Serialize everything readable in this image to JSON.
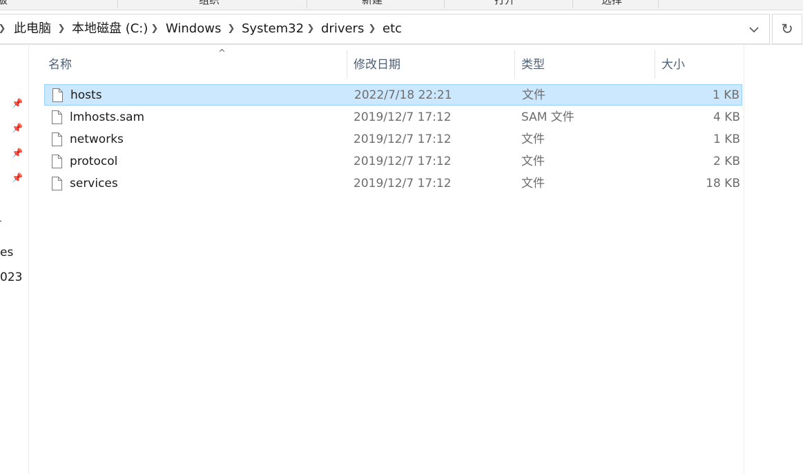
{
  "ribbon": {
    "labels": [
      "版",
      "组织",
      "新建",
      "打开",
      "选择"
    ]
  },
  "address": {
    "crumbs": [
      "此电脑",
      "本地磁盘 (C:)",
      "Windows",
      "System32",
      "drivers",
      "etc"
    ]
  },
  "nav": {
    "fragments": [
      "es",
      "023"
    ]
  },
  "columns": {
    "name": "名称",
    "date": "修改日期",
    "type": "类型",
    "size": "大小"
  },
  "files": [
    {
      "name": "hosts",
      "date": "2022/7/18 22:21",
      "type": "文件",
      "size": "1 KB",
      "selected": true
    },
    {
      "name": "lmhosts.sam",
      "date": "2019/12/7 17:12",
      "type": "SAM 文件",
      "size": "4 KB"
    },
    {
      "name": "networks",
      "date": "2019/12/7 17:12",
      "type": "文件",
      "size": "1 KB"
    },
    {
      "name": "protocol",
      "date": "2019/12/7 17:12",
      "type": "文件",
      "size": "2 KB"
    },
    {
      "name": "services",
      "date": "2019/12/7 17:12",
      "type": "文件",
      "size": "18 KB"
    }
  ],
  "colors": {
    "selection_bg": "#cce8ff",
    "selection_border": "#99d1ff",
    "header_text": "#4c607a"
  }
}
